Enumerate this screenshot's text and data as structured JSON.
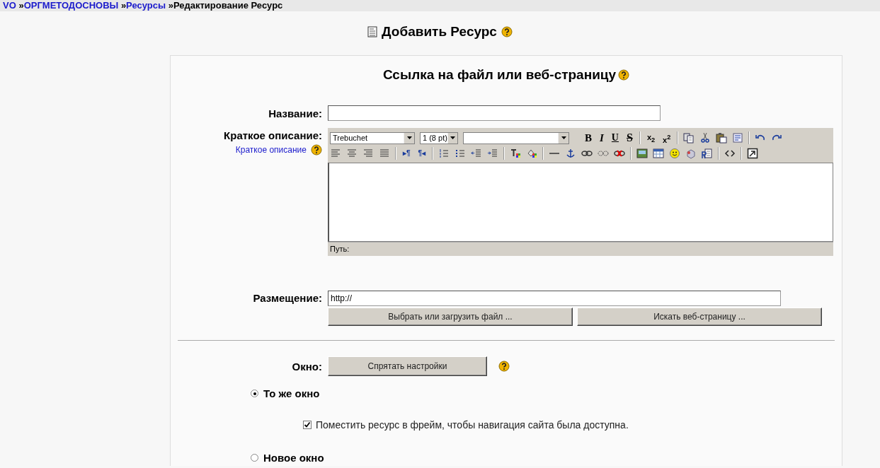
{
  "breadcrumb": {
    "separator": "»",
    "items": [
      {
        "text": "VO",
        "link": true
      },
      {
        "text": "ОРГМЕТОДОСНОВЫ",
        "link": true
      },
      {
        "text": "Ресурсы",
        "link": true
      },
      {
        "text": "Редактирование Ресурс",
        "link": false
      }
    ]
  },
  "page_title": "Добавить Ресурс",
  "form_title": "Ссылка на файл или веб-страницу",
  "name_field": {
    "label": "Название:"
  },
  "summary": {
    "label": "Краткое описание:",
    "help_link": "Краткое описание",
    "font": "Trebuchet",
    "size": "1 (8 pt)",
    "glyphs": [
      "B",
      "I",
      "U",
      "S",
      "x$_{2}$",
      "x$^{2}$",
      "▸¶",
      "¶◂"
    ],
    "path_label": "Путь:"
  },
  "location": {
    "label": "Размещение:",
    "value": "http://",
    "buttons": [
      "Выбрать или загрузить файл ...",
      "Искать веб-страницу ..."
    ]
  },
  "window": {
    "label": "Окно:",
    "button": "Спрятать настройки",
    "options": [
      {
        "label": "То же окно",
        "selected": true
      },
      {
        "label": "Новое окно",
        "selected": false
      }
    ],
    "frame_option": {
      "label": "Поместить ресурс в фрейм, чтобы навигация сайта была доступна.",
      "checked": true
    }
  }
}
